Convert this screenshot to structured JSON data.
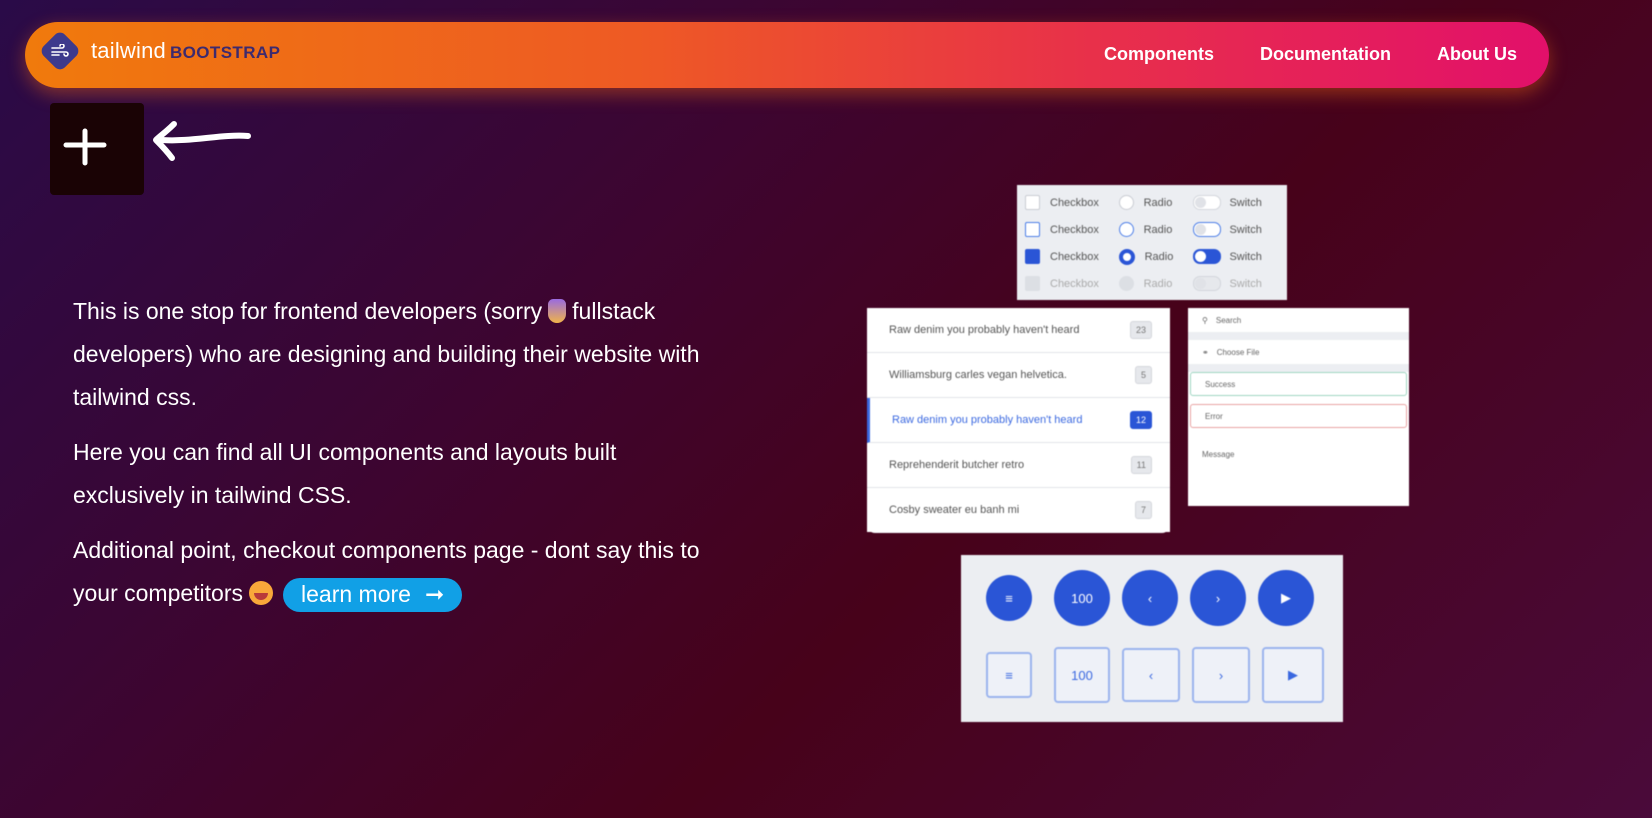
{
  "nav": {
    "logo_primary": "tailwind",
    "logo_secondary": "BOOTSTRAP",
    "links": [
      "Components",
      "Documentation",
      "About Us"
    ]
  },
  "colors": {
    "nav_gradient_start": "#f07a0c",
    "nav_gradient_end": "#e2106a",
    "accent_blue": "#11a0e6",
    "preview_blue": "#2a55d6"
  },
  "hero": {
    "p1_before": "This is one stop for frontend developers (sorry",
    "p1_after": "fullstack developers) who are designing and building their website with tailwind css.",
    "p2": "Here you can find all UI components and layouts built exclusively in tailwind CSS.",
    "p3": "Additional point, checkout components page - dont say this to your competitors",
    "learn_more": "learn more",
    "learn_more_arrow": "➞"
  },
  "preview": {
    "checks": {
      "checkbox": "Checkbox",
      "radio": "Radio",
      "switch": "Switch"
    },
    "list": [
      {
        "text": "Raw denim you probably haven't heard",
        "count": "23"
      },
      {
        "text": "Williamsburg carles vegan helvetica.",
        "count": "5"
      },
      {
        "text": "Raw denim you probably haven't heard",
        "count": "12"
      },
      {
        "text": "Reprehenderit butcher retro",
        "count": "11"
      },
      {
        "text": "Cosby sweater eu banh mi",
        "count": "7"
      }
    ],
    "form": {
      "search": "Search",
      "choose_file": "Choose File",
      "success": "Success",
      "error": "Error",
      "message": "Message"
    },
    "buttons": {
      "count_label": "100"
    }
  }
}
